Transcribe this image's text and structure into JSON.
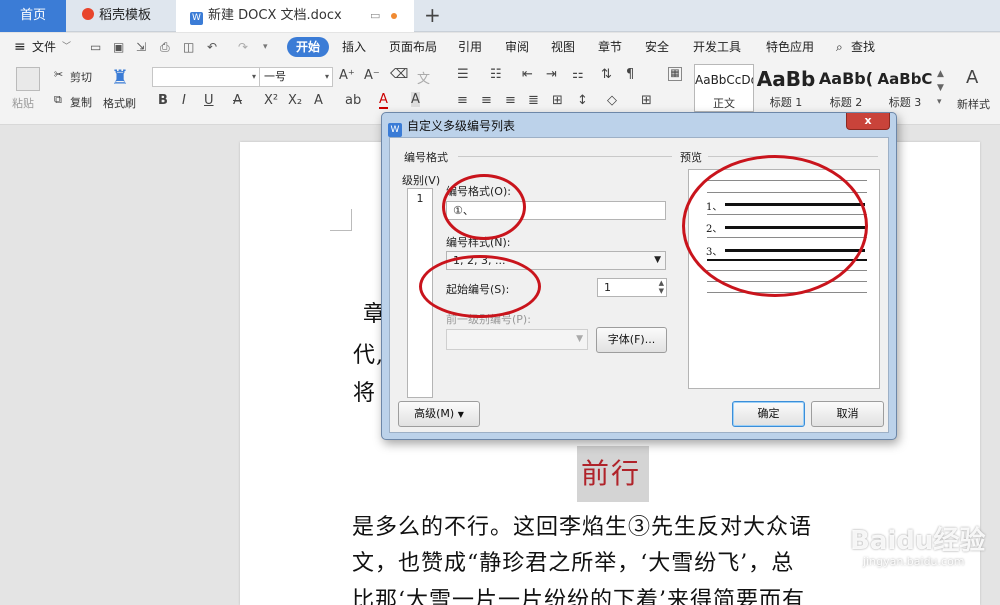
{
  "tabs": {
    "home": "首页",
    "template": "稻壳模板",
    "doc": "新建 DOCX 文档.docx"
  },
  "menu": {
    "file": "文件",
    "items": [
      "开始",
      "插入",
      "页面布局",
      "引用",
      "审阅",
      "视图",
      "章节",
      "安全",
      "开发工具",
      "特色应用"
    ],
    "search": "查找"
  },
  "ribbon": {
    "paste": "粘贴",
    "cut": "剪切",
    "copy": "复制",
    "format_painter": "格式刷",
    "font_size": "一号",
    "styles": [
      {
        "preview": "AaBbCcDd",
        "name": "正文"
      },
      {
        "preview": "AaBb",
        "name": "标题 1"
      },
      {
        "preview": "AaBb(",
        "name": "标题 2"
      },
      {
        "preview": "AaBbC",
        "name": "标题 3"
      }
    ],
    "new_style": "新样式"
  },
  "document": {
    "side_chars": [
      "章",
      "代,",
      "将"
    ],
    "heading": "前行",
    "lines": [
      "是多么的不行。这回李焰生③先生反对大众语",
      "文，也赞成“静珍君之所举，‘大雪纷飞’，总",
      "比那‘大雪一片一片纷纷的下着’来得简要而有"
    ]
  },
  "dialog": {
    "title": "自定义多级编号列表",
    "close": "x",
    "group_title": "编号格式",
    "level_label": "级别(V)",
    "level_value": "1",
    "format_label": "编号格式(O):",
    "format_value": "①、",
    "style_label": "编号样式(N):",
    "style_value": "1, 2, 3, ...",
    "start_label": "起始编号(S):",
    "start_value": "1",
    "prev_label": "前一级别编号(P):",
    "font_button": "字体(F)...",
    "preview_title": "预览",
    "preview_nums": [
      "1、",
      "2、",
      "3、"
    ],
    "advanced": "高级(M)",
    "ok": "确定",
    "cancel": "取消"
  },
  "watermark": {
    "brand": "Baidu经验",
    "url": "jingyan.baidu.com"
  },
  "colors": {
    "accent": "#3b7cd6",
    "annotation": "#c9141c",
    "highlight_text": "#b0232a"
  }
}
